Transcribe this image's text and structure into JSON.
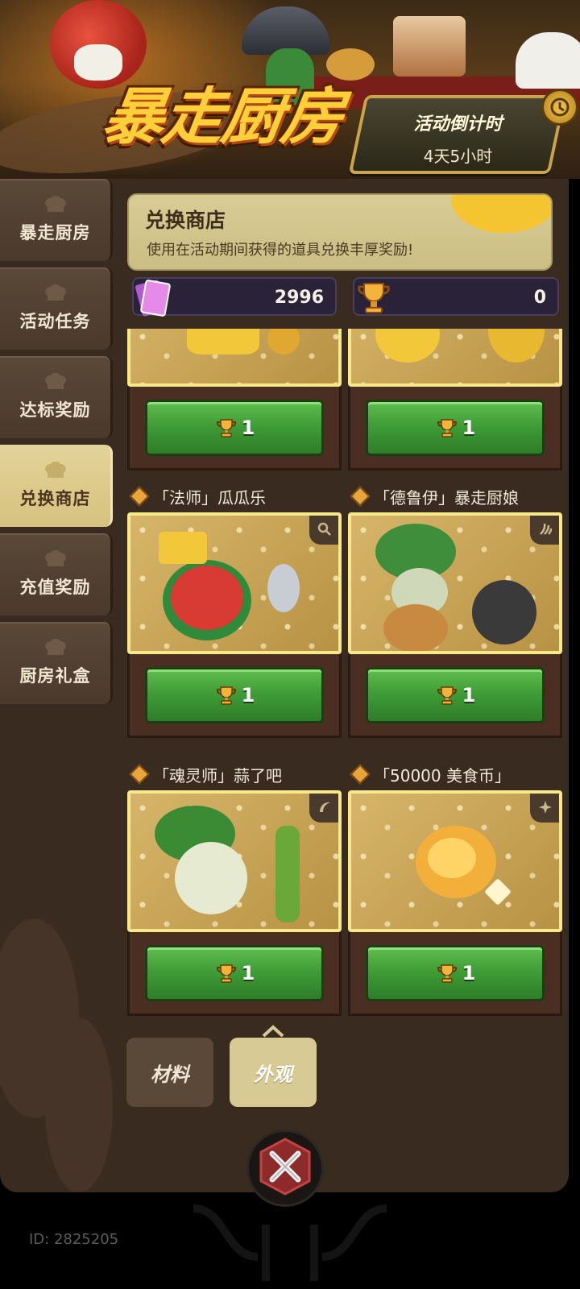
{
  "banner": {
    "title": "暴走厨房",
    "countdown_label": "活动倒计时",
    "countdown_value": "4天5小时"
  },
  "sidebar": {
    "items": [
      {
        "label": "暴走厨房",
        "active": false
      },
      {
        "label": "活动任务",
        "active": false
      },
      {
        "label": "达标奖励",
        "active": false
      },
      {
        "label": "兑换商店",
        "active": true
      },
      {
        "label": "充值奖励",
        "active": false
      },
      {
        "label": "厨房礼盒",
        "active": false
      }
    ]
  },
  "shop": {
    "title": "兑换商店",
    "subtitle": "使用在活动期间获得的道具兑换丰厚奖励!"
  },
  "currencies": [
    {
      "icon": "ticket-cards-icon",
      "value": "2996"
    },
    {
      "icon": "trophy-icon",
      "value": "0"
    }
  ],
  "items": [
    {
      "name": "",
      "price": "1",
      "currency_icon": "trophy-icon"
    },
    {
      "name": "",
      "price": "1",
      "currency_icon": "trophy-icon"
    },
    {
      "name": "「法师」瓜瓜乐",
      "price": "1",
      "class_icon": "magnifier-icon",
      "currency_icon": "trophy-icon"
    },
    {
      "name": "「德鲁伊」暴走厨娘",
      "price": "1",
      "class_icon": "claw-icon",
      "currency_icon": "trophy-icon"
    },
    {
      "name": "「魂灵师」蒜了吧",
      "price": "1",
      "class_icon": "sickle-icon",
      "currency_icon": "trophy-icon"
    },
    {
      "name": "「50000 美食币」",
      "price": "1",
      "class_icon": "sparkle-icon",
      "currency_icon": "trophy-icon"
    }
  ],
  "category_switch": {
    "options": [
      "材料",
      "外观"
    ],
    "selected": "外观"
  },
  "footer": {
    "id_text": "ID: 2825205"
  },
  "colors": {
    "panel_bg": "#3a2b20",
    "active_tab": "#d6c27e",
    "buy_button": "#3d9a35",
    "card_border": "#f7e98a"
  }
}
